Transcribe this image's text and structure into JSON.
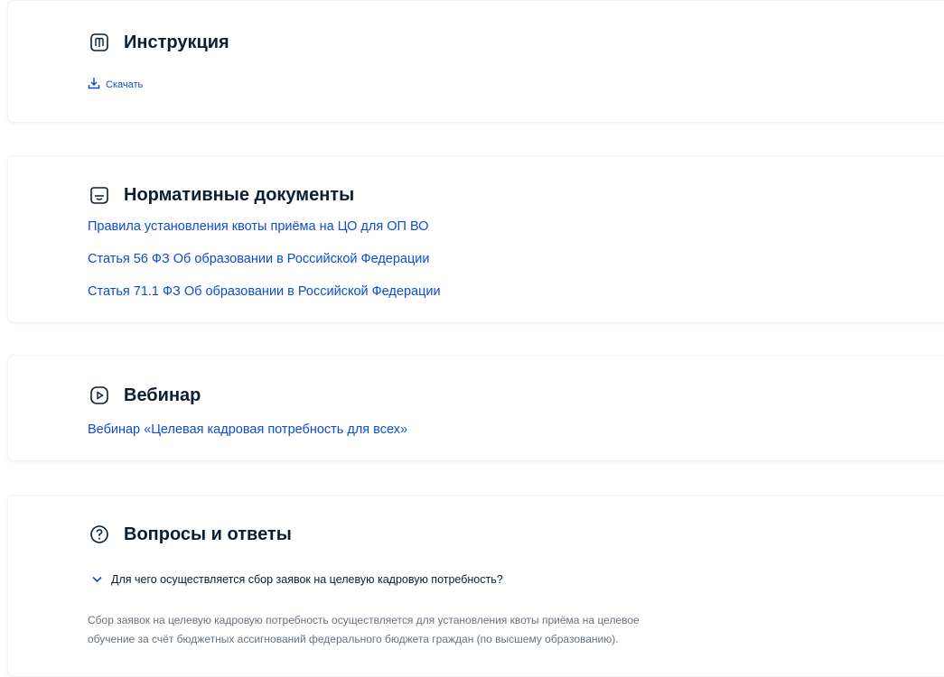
{
  "instruction": {
    "title": "Инструкция",
    "download_label": "Скачать"
  },
  "normative": {
    "title": "Нормативные документы",
    "links": [
      "Правила установления квоты приёма на ЦО для ОП ВО",
      "Статья 56 ФЗ Об образовании в Российской Федерации",
      "Статья 71.1 ФЗ Об образовании в Российской Федерации"
    ]
  },
  "webinar": {
    "title": "Вебинар",
    "link": "Вебинар «Целевая кадровая потребность для всех»"
  },
  "faq": {
    "title": "Вопросы и  ответы",
    "items": [
      {
        "question": "Для чего осуществляется сбор заявок на целевую кадровую потребность?",
        "answer_line1": "Сбор заявок на целевую кадровую потребность осуществляется для установления квоты приёма на целевое",
        "answer_line2": "обучение за счёт бюджетных ассигнований федерального бюджета граждан (по высшему образованию)."
      }
    ]
  },
  "colors": {
    "link": "#0d4cd3",
    "text": "#0b1f33",
    "muted": "#66727f"
  },
  "icons": {
    "instruction": "book-icon",
    "download": "download-icon",
    "normative": "document-icon",
    "webinar": "play-icon",
    "faq": "question-icon",
    "faq_toggle": "chevron-down-icon"
  }
}
